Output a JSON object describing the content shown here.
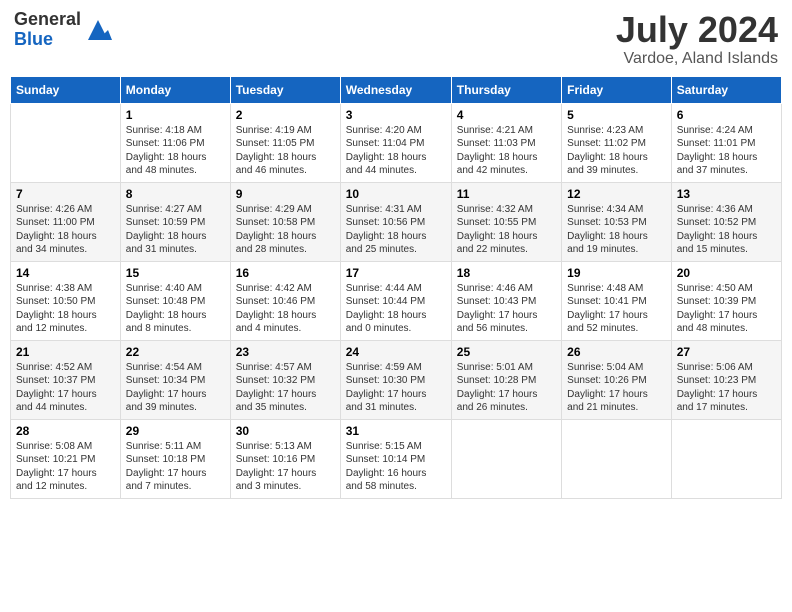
{
  "header": {
    "logo_general": "General",
    "logo_blue": "Blue",
    "month_title": "July 2024",
    "location": "Vardoe, Aland Islands"
  },
  "days_of_week": [
    "Sunday",
    "Monday",
    "Tuesday",
    "Wednesday",
    "Thursday",
    "Friday",
    "Saturday"
  ],
  "weeks": [
    [
      {
        "day": "",
        "sunrise": "",
        "sunset": "",
        "daylight": ""
      },
      {
        "day": "1",
        "sunrise": "4:18 AM",
        "sunset": "11:06 PM",
        "daylight": "18 hours and 48 minutes."
      },
      {
        "day": "2",
        "sunrise": "4:19 AM",
        "sunset": "11:05 PM",
        "daylight": "18 hours and 46 minutes."
      },
      {
        "day": "3",
        "sunrise": "4:20 AM",
        "sunset": "11:04 PM",
        "daylight": "18 hours and 44 minutes."
      },
      {
        "day": "4",
        "sunrise": "4:21 AM",
        "sunset": "11:03 PM",
        "daylight": "18 hours and 42 minutes."
      },
      {
        "day": "5",
        "sunrise": "4:23 AM",
        "sunset": "11:02 PM",
        "daylight": "18 hours and 39 minutes."
      },
      {
        "day": "6",
        "sunrise": "4:24 AM",
        "sunset": "11:01 PM",
        "daylight": "18 hours and 37 minutes."
      }
    ],
    [
      {
        "day": "7",
        "sunrise": "4:26 AM",
        "sunset": "11:00 PM",
        "daylight": "18 hours and 34 minutes."
      },
      {
        "day": "8",
        "sunrise": "4:27 AM",
        "sunset": "10:59 PM",
        "daylight": "18 hours and 31 minutes."
      },
      {
        "day": "9",
        "sunrise": "4:29 AM",
        "sunset": "10:58 PM",
        "daylight": "18 hours and 28 minutes."
      },
      {
        "day": "10",
        "sunrise": "4:31 AM",
        "sunset": "10:56 PM",
        "daylight": "18 hours and 25 minutes."
      },
      {
        "day": "11",
        "sunrise": "4:32 AM",
        "sunset": "10:55 PM",
        "daylight": "18 hours and 22 minutes."
      },
      {
        "day": "12",
        "sunrise": "4:34 AM",
        "sunset": "10:53 PM",
        "daylight": "18 hours and 19 minutes."
      },
      {
        "day": "13",
        "sunrise": "4:36 AM",
        "sunset": "10:52 PM",
        "daylight": "18 hours and 15 minutes."
      }
    ],
    [
      {
        "day": "14",
        "sunrise": "4:38 AM",
        "sunset": "10:50 PM",
        "daylight": "18 hours and 12 minutes."
      },
      {
        "day": "15",
        "sunrise": "4:40 AM",
        "sunset": "10:48 PM",
        "daylight": "18 hours and 8 minutes."
      },
      {
        "day": "16",
        "sunrise": "4:42 AM",
        "sunset": "10:46 PM",
        "daylight": "18 hours and 4 minutes."
      },
      {
        "day": "17",
        "sunrise": "4:44 AM",
        "sunset": "10:44 PM",
        "daylight": "18 hours and 0 minutes."
      },
      {
        "day": "18",
        "sunrise": "4:46 AM",
        "sunset": "10:43 PM",
        "daylight": "17 hours and 56 minutes."
      },
      {
        "day": "19",
        "sunrise": "4:48 AM",
        "sunset": "10:41 PM",
        "daylight": "17 hours and 52 minutes."
      },
      {
        "day": "20",
        "sunrise": "4:50 AM",
        "sunset": "10:39 PM",
        "daylight": "17 hours and 48 minutes."
      }
    ],
    [
      {
        "day": "21",
        "sunrise": "4:52 AM",
        "sunset": "10:37 PM",
        "daylight": "17 hours and 44 minutes."
      },
      {
        "day": "22",
        "sunrise": "4:54 AM",
        "sunset": "10:34 PM",
        "daylight": "17 hours and 39 minutes."
      },
      {
        "day": "23",
        "sunrise": "4:57 AM",
        "sunset": "10:32 PM",
        "daylight": "17 hours and 35 minutes."
      },
      {
        "day": "24",
        "sunrise": "4:59 AM",
        "sunset": "10:30 PM",
        "daylight": "17 hours and 31 minutes."
      },
      {
        "day": "25",
        "sunrise": "5:01 AM",
        "sunset": "10:28 PM",
        "daylight": "17 hours and 26 minutes."
      },
      {
        "day": "26",
        "sunrise": "5:04 AM",
        "sunset": "10:26 PM",
        "daylight": "17 hours and 21 minutes."
      },
      {
        "day": "27",
        "sunrise": "5:06 AM",
        "sunset": "10:23 PM",
        "daylight": "17 hours and 17 minutes."
      }
    ],
    [
      {
        "day": "28",
        "sunrise": "5:08 AM",
        "sunset": "10:21 PM",
        "daylight": "17 hours and 12 minutes."
      },
      {
        "day": "29",
        "sunrise": "5:11 AM",
        "sunset": "10:18 PM",
        "daylight": "17 hours and 7 minutes."
      },
      {
        "day": "30",
        "sunrise": "5:13 AM",
        "sunset": "10:16 PM",
        "daylight": "17 hours and 3 minutes."
      },
      {
        "day": "31",
        "sunrise": "5:15 AM",
        "sunset": "10:14 PM",
        "daylight": "16 hours and 58 minutes."
      },
      {
        "day": "",
        "sunrise": "",
        "sunset": "",
        "daylight": ""
      },
      {
        "day": "",
        "sunrise": "",
        "sunset": "",
        "daylight": ""
      },
      {
        "day": "",
        "sunrise": "",
        "sunset": "",
        "daylight": ""
      }
    ]
  ],
  "labels": {
    "sunrise": "Sunrise:",
    "sunset": "Sunset:",
    "daylight": "Daylight:"
  }
}
